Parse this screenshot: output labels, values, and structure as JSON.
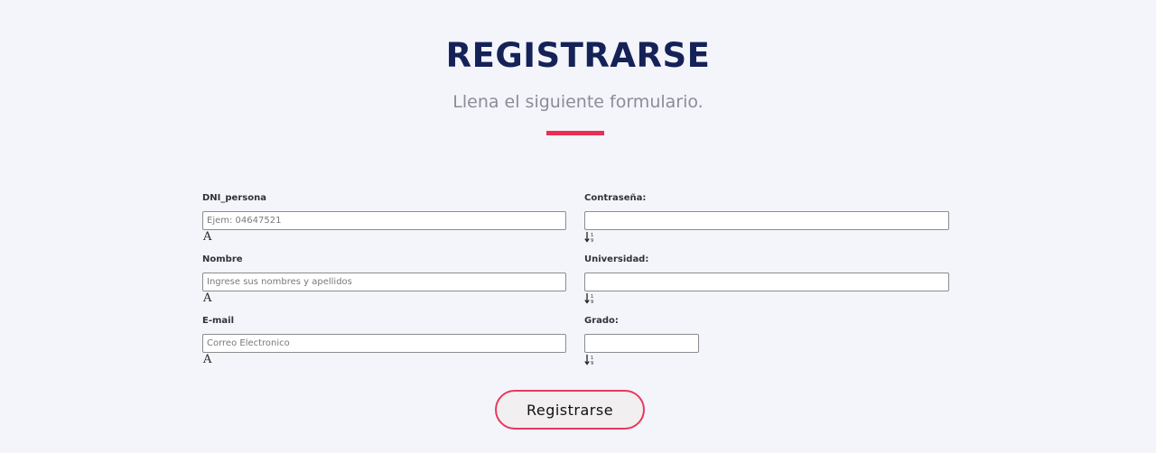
{
  "header": {
    "title": "REGISTRARSE",
    "subtitle": "Llena el siguiente formulario."
  },
  "form": {
    "fields": [
      {
        "label": "DNI_persona",
        "placeholder": "Ejem: 04647521",
        "value": "",
        "icon": "text-format-icon"
      },
      {
        "label": "Contraseña:",
        "placeholder": "",
        "value": "",
        "icon": "sort-down-icon"
      },
      {
        "label": "Nombre",
        "placeholder": "Ingrese sus nombres y apellidos",
        "value": "",
        "icon": "text-format-icon"
      },
      {
        "label": "Universidad:",
        "placeholder": "",
        "value": "",
        "icon": "sort-down-icon"
      },
      {
        "label": "E-mail",
        "placeholder": "Correo Electronico",
        "value": "",
        "icon": "text-format-icon"
      },
      {
        "label": "Grado:",
        "placeholder": "",
        "value": "",
        "icon": "sort-down-icon"
      }
    ],
    "icon_a_glyph": "A",
    "submit_label": "Registrarse"
  },
  "colors": {
    "title": "#152257",
    "accent": "#ec2d55",
    "background": "#f4f5fb"
  }
}
